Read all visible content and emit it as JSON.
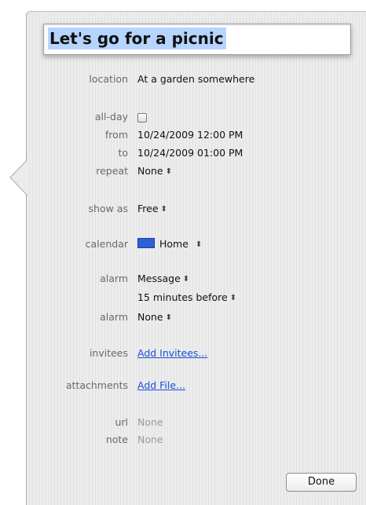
{
  "event": {
    "title": "Let's go for a picnic"
  },
  "fields": {
    "location": {
      "label": "location",
      "value": "At a garden somewhere"
    },
    "all_day": {
      "label": "all-day",
      "checked": false
    },
    "from": {
      "label": "from",
      "value": "10/24/2009 12:00 PM"
    },
    "to": {
      "label": "to",
      "value": "10/24/2009 01:00 PM"
    },
    "repeat": {
      "label": "repeat",
      "value": "None"
    },
    "show_as": {
      "label": "show as",
      "value": "Free"
    },
    "calendar": {
      "label": "calendar",
      "value": "Home",
      "color": "#2e5fd6"
    },
    "alarm1": {
      "label": "alarm",
      "type": "Message",
      "timing": "15 minutes before"
    },
    "alarm2": {
      "label": "alarm",
      "value": "None"
    },
    "invitees": {
      "label": "invitees",
      "link": "Add Invitees..."
    },
    "attachments": {
      "label": "attachments",
      "link": "Add File..."
    },
    "url": {
      "label": "url",
      "value": "None"
    },
    "note": {
      "label": "note",
      "value": "None"
    }
  },
  "buttons": {
    "done": "Done"
  },
  "icons": {
    "stepper": "up-down-arrows-icon",
    "checkbox": "checkbox-icon",
    "calendar_swatch": "calendar-color-swatch-icon"
  }
}
